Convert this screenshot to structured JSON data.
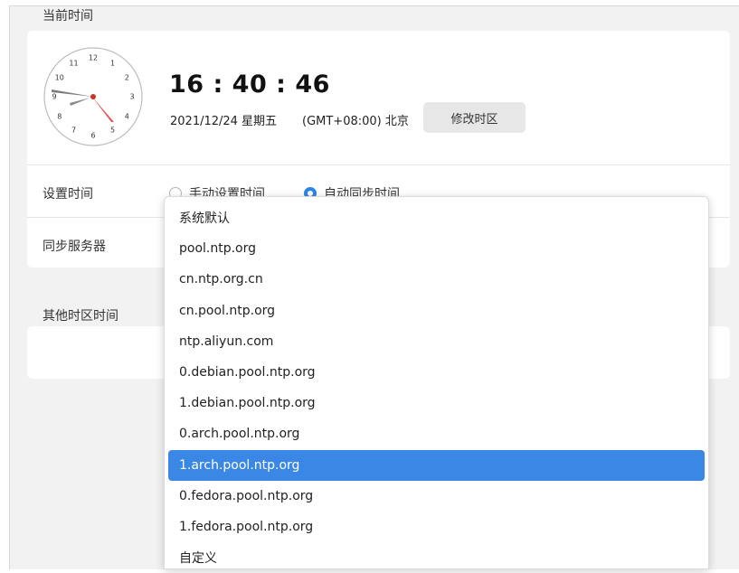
{
  "current_time_section": {
    "title": "当前时间",
    "time": "16 : 40 : 46",
    "date": "2021/12/24  星期五",
    "timezone": "(GMT+08:00) 北京",
    "change_timezone_label": "修改时区"
  },
  "clock": {
    "numbers": [
      "12",
      "1",
      "2",
      "3",
      "4",
      "5",
      "6",
      "7",
      "8",
      "9",
      "10",
      "11"
    ],
    "hour_hand_color": "#888888",
    "second_hand_color": "#e8544f"
  },
  "set_time": {
    "label": "设置时间",
    "manual_label": "手动设置时间",
    "auto_label": "自动同步时间",
    "selected": "auto"
  },
  "sync_server": {
    "label": "同步服务器"
  },
  "other_timezones": {
    "title": "其他时区时间"
  },
  "dropdown": {
    "options": [
      "系统默认",
      "pool.ntp.org",
      "cn.ntp.org.cn",
      "cn.pool.ntp.org",
      "ntp.aliyun.com",
      "0.debian.pool.ntp.org",
      "1.debian.pool.ntp.org",
      "0.arch.pool.ntp.org",
      "1.arch.pool.ntp.org",
      "0.fedora.pool.ntp.org",
      "1.fedora.pool.ntp.org",
      "自定义"
    ],
    "selected_index": 8,
    "highlight_color": "#3a87e6"
  }
}
